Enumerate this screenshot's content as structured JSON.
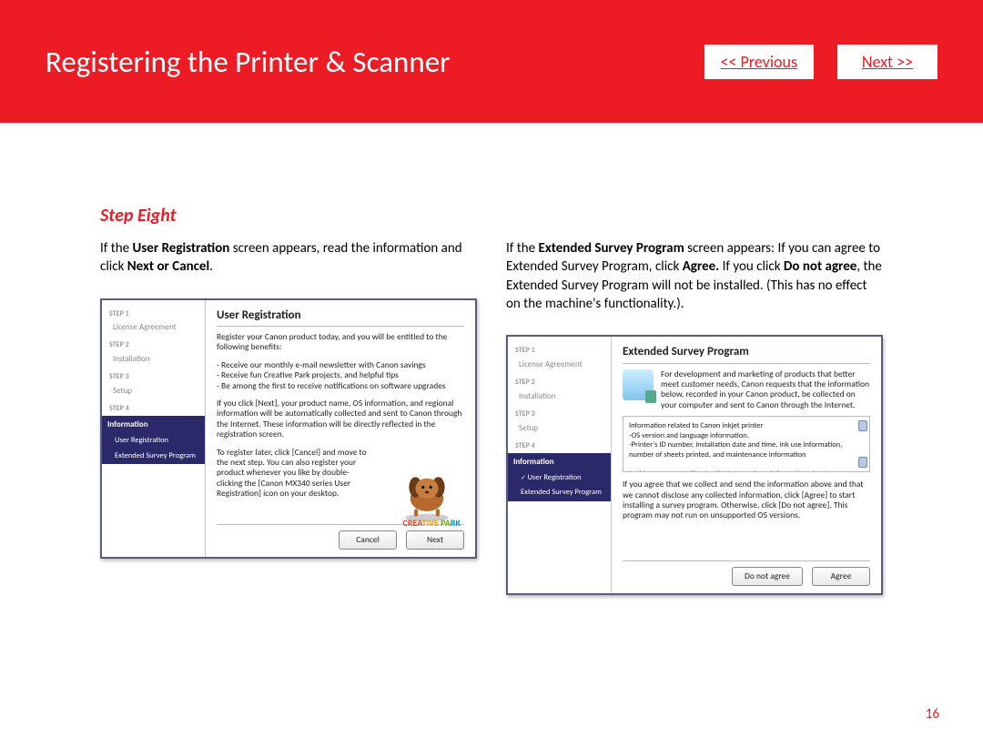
{
  "banner": {
    "title": "Registering the Printer & Scanner",
    "prev": "<< Previous",
    "next": "Next >>"
  },
  "step_heading": "Step Eight",
  "left": {
    "intro_html": "If the <b>User Registration</b> screen appears, read the information and click <b>Next or Cancel</b>.",
    "dialog": {
      "title": "User Registration",
      "p1": "Register your Canon product today, and you will be entitled to the following benefits:",
      "p2": "- Receive our monthly e-mail newsletter with Canon savings\n- Receive fun Creative Park projects, and helpful tips\n- Be among the first to receive notifications on software upgrades",
      "p3": "If you click [Next], your product name, OS information, and regional information will be automatically collected and sent to Canon through the Internet. These information will be directly reflected in the registration screen.",
      "p4": "To register later, click [Cancel] and move to the next step. You can also register your product whenever you like by double-clicking the [Canon MX340 series User Registration] icon on your desktop.",
      "creative": "CREATIVE PARK",
      "btn_cancel": "Cancel",
      "btn_next": "Next"
    },
    "sidebar": {
      "s1": "STEP 1",
      "i1": "License Agreement",
      "s2": "STEP 2",
      "i2": "Installation",
      "s3": "STEP 3",
      "i3": "Setup",
      "s4": "STEP 4",
      "active": "Information",
      "sub1": "User Registration",
      "sub2": "Extended Survey Program"
    }
  },
  "right": {
    "intro_html": "If the <b>Extended Survey Program</b> screen appears: If you can agree to Extended Survey Program, click <b>Agree.</b> If you click <b>Do not agree</b>, the Extended Survey Program will not be installed. (This has no effect on the machine's functionality.).",
    "dialog": {
      "title": "Extended Survey Program",
      "info": "For development and marketing of products that better meet customer needs, Canon requests that the information below, recorded in your Canon product, be collected on your computer and sent to Canon through the Internet.",
      "box1": "Information related to Canon inkjet printer\n-OS version and language information.\n-Printer's ID number, installation date and time, ink use information, number of sheets printed, and maintenance information\n\nIn this survey, we will not collect or send any information about your computer other than that above or any of your personal information. For this reason, from the",
      "p2": "If you agree that we collect and send the information above and that we cannot disclose any collected information, click [Agree] to start installing a survey program. Otherwise, click [Do not agree]. This program may not run on unsupported OS versions.",
      "btn_no": "Do not agree",
      "btn_yes": "Agree"
    },
    "sidebar": {
      "s1": "STEP 1",
      "i1": "License Agreement",
      "s2": "STEP 2",
      "i2": "Installation",
      "s3": "STEP 3",
      "i3": "Setup",
      "s4": "STEP 4",
      "active": "Information",
      "sub1": "User Registration",
      "sub2": "Extended Survey Program"
    }
  },
  "page_number": "16"
}
